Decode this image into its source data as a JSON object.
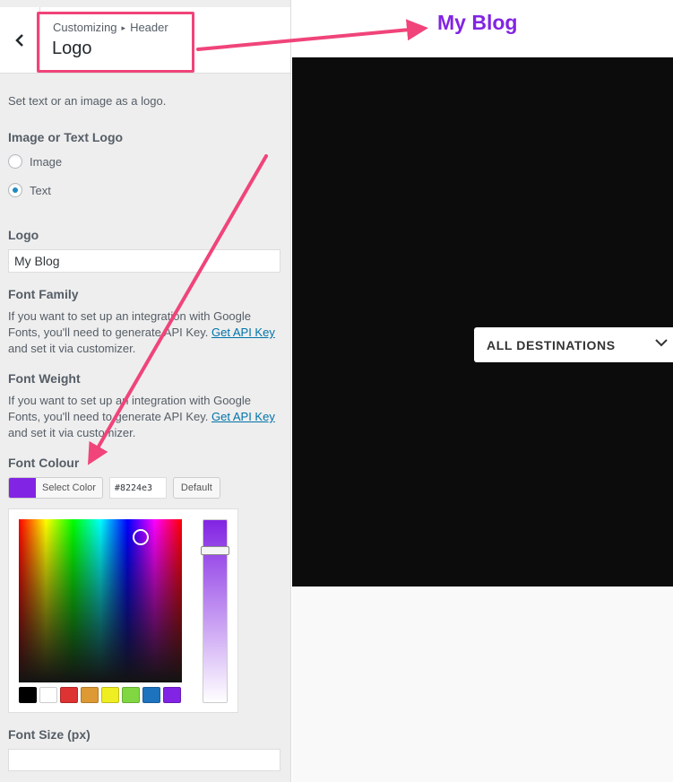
{
  "customizer": {
    "breadcrumb_parent": "Customizing",
    "breadcrumb_separator": "▸",
    "breadcrumb_section": "Header",
    "section_title": "Logo",
    "description": "Set text or an image as a logo.",
    "logo_type": {
      "title": "Image or Text Logo",
      "options": [
        "Image",
        "Text"
      ],
      "selected": "Text"
    },
    "logo_text": {
      "title": "Logo",
      "value": "My Blog"
    },
    "font_family": {
      "title": "Font Family",
      "help_before": "If you want to set up an integration with Google Fonts, you'll need to generate API Key.",
      "link": "Get API Key",
      "help_after": "and set it via customizer."
    },
    "font_weight": {
      "title": "Font Weight",
      "help_before": "If you want to set up an integration with Google Fonts, you'll need to generate API Key.",
      "link": "Get API Key",
      "help_after": "and set it via customizer."
    },
    "font_colour": {
      "title": "Font Colour",
      "select_label": "Select Color",
      "hex_value": "#8224e3",
      "default_label": "Default",
      "current_color": "#8224e3",
      "palette": [
        "#000000",
        "#ffffff",
        "#dd3333",
        "#dd9933",
        "#eeee22",
        "#81d742",
        "#1e73be",
        "#8224e3"
      ]
    },
    "font_size": {
      "title": "Font Size (px)",
      "value": ""
    }
  },
  "preview": {
    "site_title": "My Blog",
    "destinations_label": "ALL DESTINATIONS"
  },
  "annotation_color": "#f0447a"
}
